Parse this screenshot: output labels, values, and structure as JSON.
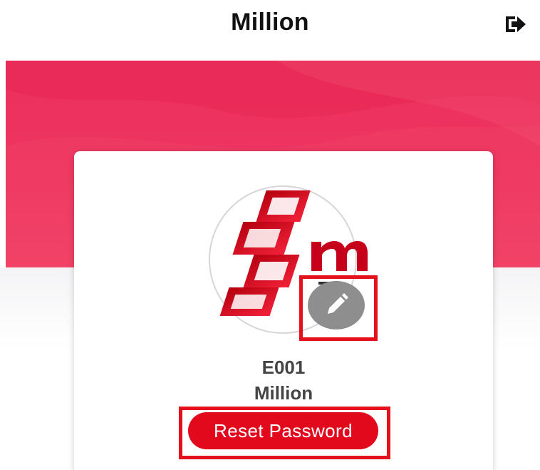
{
  "header": {
    "title": "Million",
    "logout_icon": "logout-icon"
  },
  "profile": {
    "avatar_icon": "company-logo",
    "edit_icon": "pencil-icon",
    "employee_id": "E001",
    "employee_name": "Million",
    "reset_button_label": "Reset Password"
  },
  "colors": {
    "banner": "#ec2f5f",
    "accent": "#e3091d",
    "highlight_border": "#e4111c",
    "edit_button": "#8e8e8e"
  }
}
